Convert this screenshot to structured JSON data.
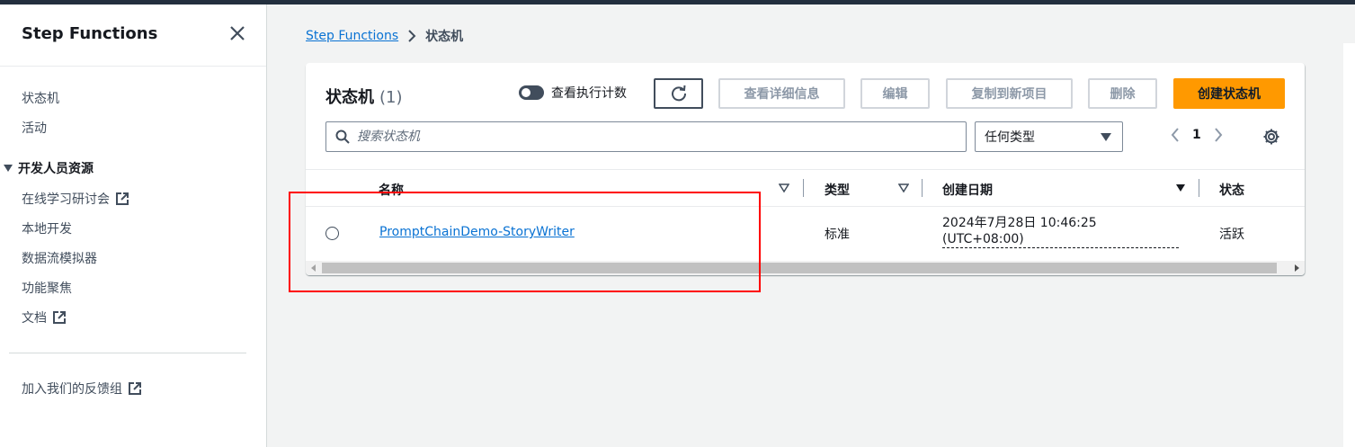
{
  "sidebar": {
    "title": "Step Functions",
    "items": [
      {
        "label": "状态机"
      },
      {
        "label": "活动"
      }
    ],
    "section_label": "开发人员资源",
    "dev_items": [
      {
        "label": "在线学习研讨会"
      },
      {
        "label": "本地开发"
      },
      {
        "label": "数据流模拟器"
      },
      {
        "label": "功能聚焦"
      },
      {
        "label": "文档"
      }
    ],
    "feedback_label": "加入我们的反馈组"
  },
  "breadcrumb": {
    "root": "Step Functions",
    "current": "状态机"
  },
  "card": {
    "title": "状态机",
    "count": "(1)",
    "toggle_label": "查看执行计数",
    "buttons": {
      "details": "查看详细信息",
      "edit": "编辑",
      "copy": "复制到新项目",
      "delete": "删除",
      "create": "创建状态机"
    },
    "search_placeholder": "搜索状态机",
    "type_filter": "任何类型",
    "page": "1"
  },
  "table": {
    "columns": [
      "名称",
      "类型",
      "创建日期",
      "状态"
    ],
    "rows": [
      {
        "name": "PromptChainDemo-StoryWriter",
        "type": "标准",
        "created_line1": "2024年7月28日 10:46:25",
        "created_line2": "(UTC+08:00)",
        "status": "活跃"
      }
    ]
  },
  "colors": {
    "primary_button": "#ff9900",
    "link": "#0972d3",
    "annotation": "#ff0000"
  }
}
